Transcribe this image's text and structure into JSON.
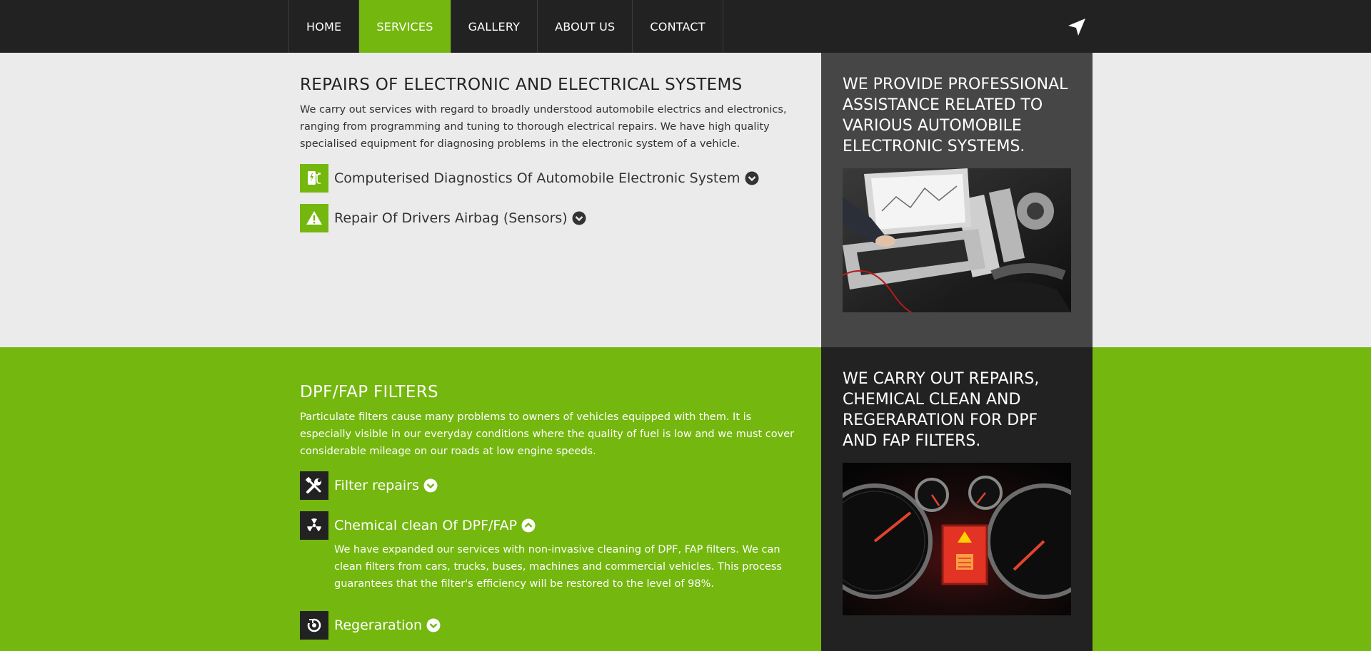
{
  "nav": {
    "items": [
      {
        "label": "HOME",
        "active": false
      },
      {
        "label": "SERVICES",
        "active": true
      },
      {
        "label": "GALLERY",
        "active": false
      },
      {
        "label": "ABOUT US",
        "active": false
      },
      {
        "label": "CONTACT",
        "active": false
      }
    ],
    "locate_icon": "location-arrow-icon"
  },
  "colors": {
    "accent": "#74b70f",
    "nav_bg": "#222222",
    "light_bg": "#ebebeb",
    "side_dark": "#464646",
    "side_darker": "#222222"
  },
  "electronics": {
    "title": "REPAIRS OF ELECTRONIC AND ELECTRICAL SYSTEMS",
    "lead": "We carry out services with regard to broadly understood automobile electrics and electronics, ranging from programming and tuning to thorough electrical repairs. We have high quality specialised equipment for diagnosing problems in the electronic system of a vehicle.",
    "items": [
      {
        "title": "Computerised Diagnostics Of Automobile Electronic System",
        "icon": "diagnostics-charger-icon",
        "expanded": false
      },
      {
        "title": "Repair Of Drivers Airbag (Sensors)",
        "icon": "warning-triangle-icon",
        "expanded": false
      }
    ],
    "side_title": "WE PROVIDE PROFESSIONAL ASSISTANCE RELATED TO VARIOUS AUTOMOBILE ELECTRONIC SYSTEMS.",
    "side_image": "laptop-engine-diagnostics-photo"
  },
  "filters": {
    "title": "DPF/FAP FILTERS",
    "lead": "Particulate filters cause many problems to owners of vehicles equipped with them. It is especially visible in our everyday conditions where the quality of fuel is low and we must cover considerable mileage on our roads at low engine speeds.",
    "items": [
      {
        "title": "Filter repairs",
        "icon": "wrench-screwdriver-icon",
        "expanded": false
      },
      {
        "title": "Chemical clean Of DPF/FAP",
        "icon": "radiation-icon",
        "expanded": true,
        "body": "We have expanded our services with non-invasive cleaning of DPF, FAP filters. We can clean filters from cars, trucks, buses, machines and commercial vehicles. This process guarantees that the filter's efficiency will be restored to the level of 98%."
      },
      {
        "title": "Regeraration",
        "icon": "regeneration-cycle-icon",
        "expanded": false
      }
    ],
    "side_title": "WE CARRY OUT REPAIRS, CHEMICAL CLEAN AND REGERARATION FOR DPF AND FAP FILTERS.",
    "side_image": "dashboard-dpf-warning-photo"
  }
}
